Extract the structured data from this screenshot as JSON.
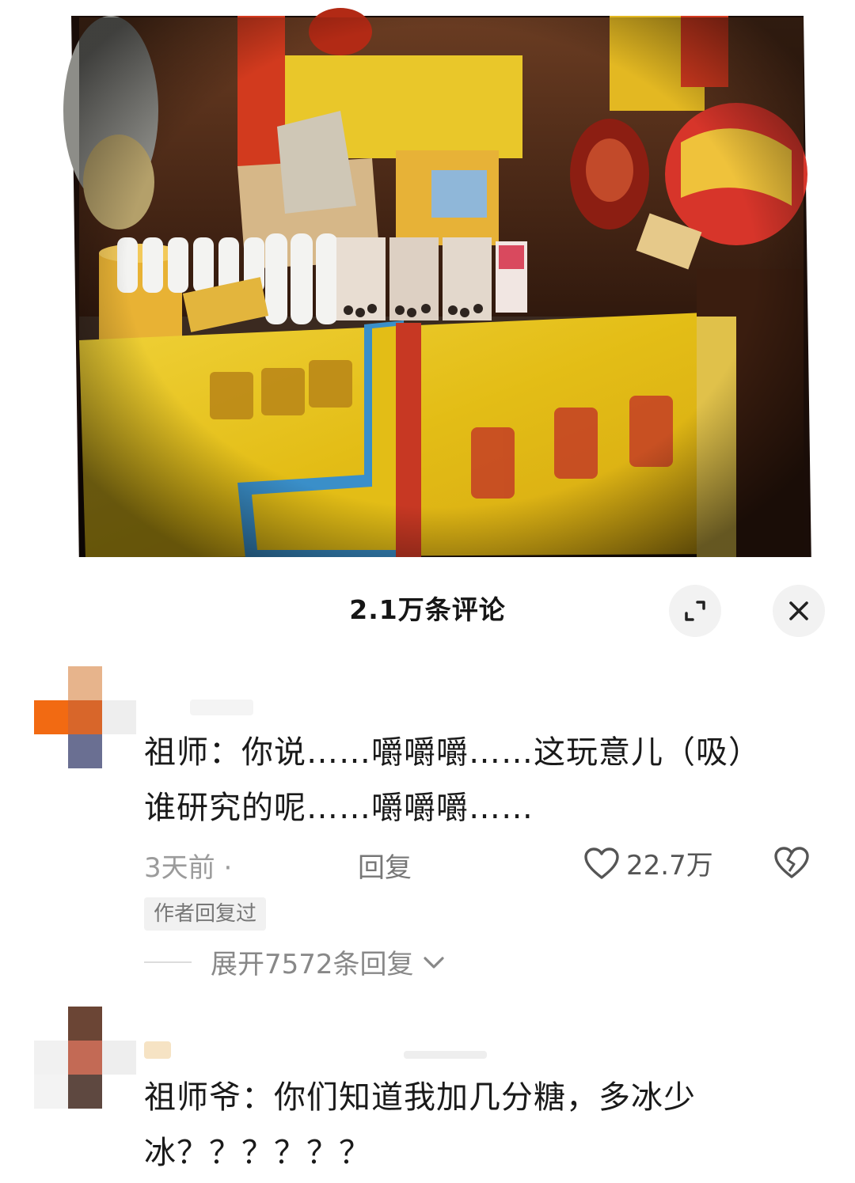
{
  "comments_panel": {
    "title": "2.1万条评论",
    "expand_icon": "expand-icon",
    "close_icon": "close-icon"
  },
  "comments": [
    {
      "text_line1": "祖师：你说……嚼嚼嚼……这玩意儿（吸）",
      "text_line2": "谁研究的呢……嚼嚼嚼……",
      "time": "3天前 ·",
      "reply_label": "回复",
      "likes": "22.7万",
      "author_tag": "作者回复过",
      "expand_replies": "展开7572条回复"
    },
    {
      "text_line1": "祖师爷：你们知道我加几分糖，多冰少",
      "text_line2": "冰？？？？？？"
    }
  ],
  "colors": {
    "altar_yellow": "#e6c21a",
    "accent_red": "#c9301e",
    "text_gray": "#9b9b9b"
  }
}
